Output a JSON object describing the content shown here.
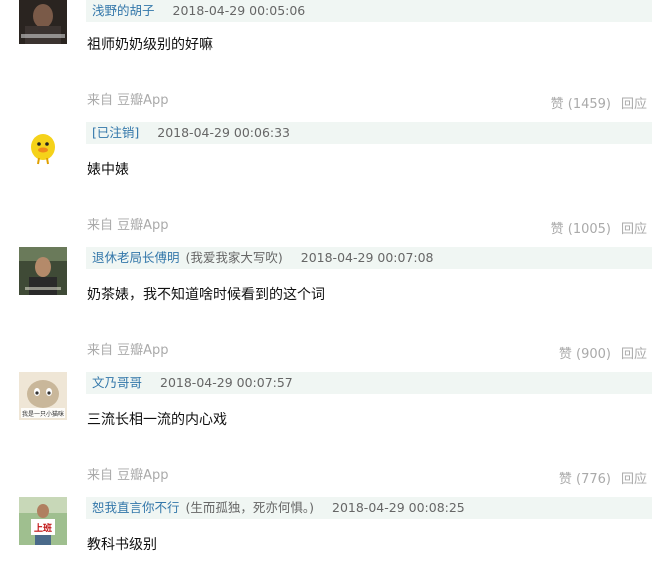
{
  "comments": [
    {
      "user": "浅野的胡子",
      "signature": "",
      "time": "2018-04-29 00:05:06",
      "text": "祖师奶奶级别的好嘛",
      "source": "来自 豆瓣App",
      "like_label": "赞 (1459)",
      "reply_label": "回应"
    },
    {
      "user": "[已注销]",
      "signature": "",
      "time": "2018-04-29 00:06:33",
      "text": "婊中婊",
      "source": "来自 豆瓣App",
      "like_label": "赞 (1005)",
      "reply_label": "回应"
    },
    {
      "user": "退休老局长傅明",
      "signature": "(我爱我家大写吹)",
      "time": "2018-04-29 00:07:08",
      "text": "奶茶婊，我不知道啥时候看到的这个词",
      "source": "来自 豆瓣App",
      "like_label": "赞 (900)",
      "reply_label": "回应"
    },
    {
      "user": "文乃哥哥",
      "signature": "",
      "time": "2018-04-29 00:07:57",
      "text": "三流长相一流的内心戏",
      "source": "来自 豆瓣App",
      "like_label": "赞 (776)",
      "reply_label": "回应"
    },
    {
      "user": "恕我直言你不行",
      "signature": "(生而孤独，死亦何惧。)",
      "time": "2018-04-29 00:08:25",
      "text": "教科书级别",
      "source": "",
      "like_label": "",
      "reply_label": ""
    }
  ],
  "avatar_texts": {
    "a4_top": "我是一只小猫咪",
    "a5_sign": "上班"
  },
  "colors": {
    "link": "#3377aa",
    "meta_bg": "#f0f6f3",
    "muted": "#aaaaaa"
  }
}
